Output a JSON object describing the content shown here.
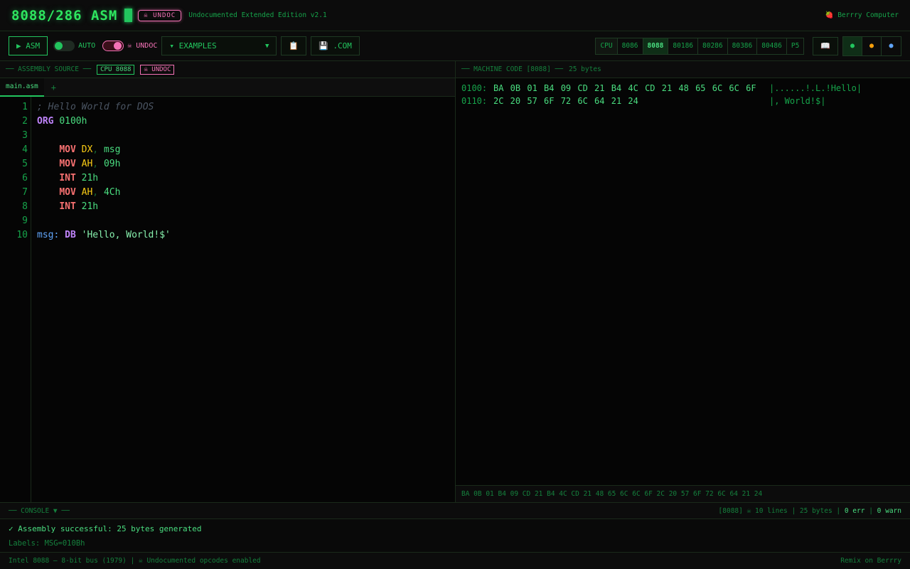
{
  "header": {
    "title": "8088/286 ASM",
    "undoc_badge": "☠ UNDOC",
    "subtitle": "Undocumented Extended Edition v2.1",
    "brand": "🍓 Berrry Computer"
  },
  "toolbar": {
    "asm_label": "▶ ASM",
    "auto_label": "AUTO",
    "undoc_label": "☠ UNDOC",
    "examples_label": "▾ EXAMPLES",
    "copy_icon": "📋",
    "save_label": "💾 .COM",
    "cpu_label": "CPU",
    "cpus": [
      "8086",
      "8088",
      "80186",
      "80286",
      "80386",
      "80486",
      "P5"
    ],
    "selected_cpu": "8088",
    "book_icon": "📖",
    "themes": [
      {
        "symbol": "●",
        "color": "#22c55e"
      },
      {
        "symbol": "●",
        "color": "#f59e0b"
      },
      {
        "symbol": "●",
        "color": "#60a5fa"
      }
    ]
  },
  "source": {
    "header": "── ASSEMBLY SOURCE ──",
    "cpu_tag": "CPU 8088",
    "undoc_tag": "☠ UNDOC",
    "tab_name": "main.asm",
    "tab_add": "+",
    "line_numbers": [
      "1",
      "2",
      "3",
      "4",
      "5",
      "6",
      "7",
      "8",
      "9",
      "10"
    ],
    "l1_comment": "; Hello World for DOS",
    "l2_dir": "ORG",
    "l2_val": "0100h",
    "l4_op": "MOV",
    "l4_reg": "DX",
    "l4_val": "msg",
    "l5_op": "MOV",
    "l5_reg": "AH",
    "l5_val": "09h",
    "l6_op": "INT",
    "l6_val": "21h",
    "l7_op": "MOV",
    "l7_reg": "AH",
    "l7_val": "4Ch",
    "l8_op": "INT",
    "l8_val": "21h",
    "l10_label": "msg:",
    "l10_dir": "DB",
    "l10_str": "'Hello, World!$'"
  },
  "machine": {
    "header": "── MACHINE CODE [8088] ──",
    "size": "25 bytes",
    "rows": [
      {
        "addr": "0100:",
        "bytes": "BA 0B 01 B4 09 CD 21 B4 4C CD 21 48 65 6C 6C 6F",
        "ascii": "|......!.L.!Hello|"
      },
      {
        "addr": "0110:",
        "bytes": "2C 20 57 6F 72 6C 64 21 24",
        "ascii": "|, World!$|"
      }
    ],
    "raw": "BA 0B 01 B4 09 CD 21 B4 4C CD 21 48 65 6C 6C 6F 2C 20 57 6F 72 6C 64 21 24"
  },
  "console": {
    "header": "── CONSOLE ▼ ──",
    "stats_prefix": "[8088] ☠ 10 lines | 25 bytes |",
    "errors": "0 err",
    "sep": "|",
    "warnings": "0 warn",
    "success": "✓ Assembly successful: 25 bytes generated",
    "labels": "Labels: MSG=010Bh"
  },
  "footer": {
    "left": "Intel 8088 — 8-bit bus (1979) | ☠ Undocumented opcodes enabled",
    "right": "Remix on Berrry"
  }
}
